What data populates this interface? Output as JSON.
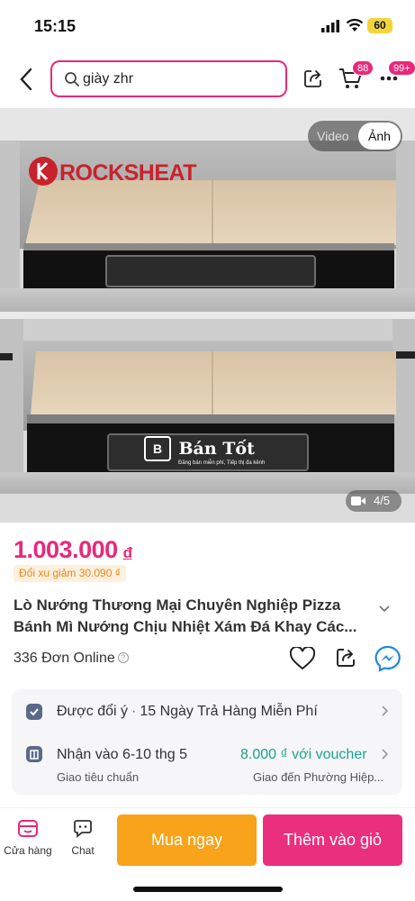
{
  "status": {
    "time": "15:15",
    "battery": "60"
  },
  "search": {
    "query": "giày zhr"
  },
  "header": {
    "cart_count": "88",
    "more_count": "99+"
  },
  "gallery": {
    "brand_text": "ROCKSHEAT",
    "video_label": "Video",
    "photo_label": "Ảnh",
    "watermark_logo": "B",
    "watermark_title": "Bán Tốt",
    "watermark_sub": "Đăng bán miễn phí, Tiếp thị đa kênh",
    "counter": "4/5"
  },
  "product": {
    "price": "1.003.000",
    "currency": "đ",
    "coin_note": "Đổi xu giảm 30.090 ₫",
    "title": "Lò Nướng Thương Mại Chuyên Nghiệp Pizza Bánh Mì Nướng Chịu Nhiệt Xám Đá Khay Các...",
    "sold": "336 Đơn Online"
  },
  "info": {
    "return_label": "Được đổi ý",
    "return_detail": "15 Ngày Trả Hàng Miễn Phí",
    "delivery_label": "Nhận vào 6-10 thg 5",
    "delivery_voucher": "8.000 ₫ với voucher",
    "delivery_type": "Giao tiêu chuẩn",
    "delivery_to": "Giao đến Phường Hiệp..."
  },
  "bottom": {
    "store_label": "Cửa hàng",
    "chat_label": "Chat",
    "buy_now": "Mua ngay",
    "add_to_cart": "Thêm vào giỏ"
  },
  "colors": {
    "accent": "#e8297a",
    "buy": "#f8a31a",
    "voucher": "#1aa58e"
  }
}
